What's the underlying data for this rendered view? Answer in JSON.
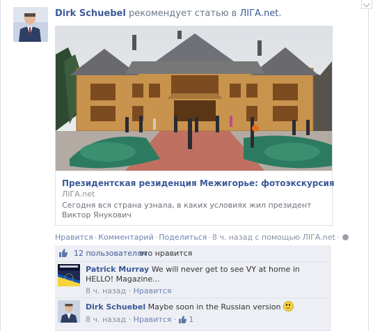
{
  "story": {
    "actor": "Dirk Schuebel",
    "verb": " рекомендует статью в ",
    "site": "ЛІГА.net",
    "end": "."
  },
  "attachment": {
    "title": "Президентская резиденция Межигорье: фотоэкскурсия",
    "source": "ЛІГА.net",
    "description": "Сегодня вся страна узнала, в каких условиях жил президент Виктор Янукович"
  },
  "actions": {
    "like": "Нравится",
    "comment": "Комментарий",
    "share": "Поделиться",
    "time": "8 ч. назад с помощью ЛІГА.net"
  },
  "likes": {
    "count": "12 пользователям",
    "text": "это нравится"
  },
  "comments": [
    {
      "author": "Patrick Murray",
      "text": "We will never get to see VY at home in HELLO! Magazine...",
      "time": "8 ч. назад",
      "like": "Нравится"
    },
    {
      "author": "Dirk Schuebel",
      "text": "Maybe soon in the Russian version",
      "time": "8 ч. назад",
      "like": "Нравится",
      "like_count": "1"
    }
  ],
  "colors": {
    "link": "#3b5998",
    "muted_link": "#6d84b4",
    "comment_bg": "#edeff4"
  }
}
